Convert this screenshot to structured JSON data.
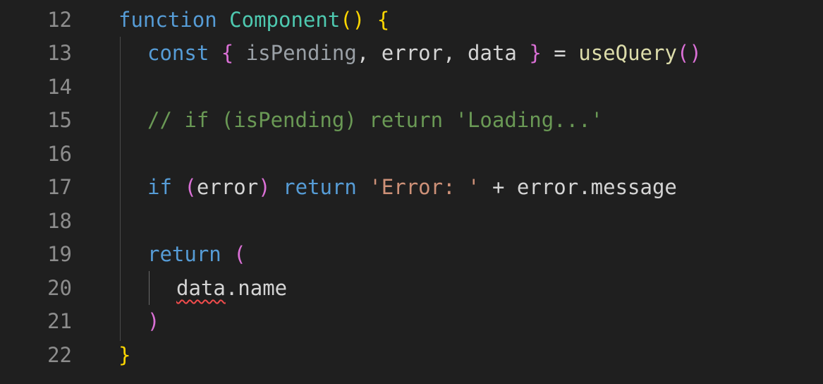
{
  "editor": {
    "line_numbers": [
      "12",
      "13",
      "14",
      "15",
      "16",
      "17",
      "18",
      "19",
      "20",
      "21",
      "22"
    ],
    "lines": {
      "l12": {
        "kw_function": "function",
        "name": "Component",
        "parens": "()",
        "brace_open": "{"
      },
      "l13": {
        "kw_const": "const",
        "brace_open": "{",
        "v1": "isPending",
        "comma1": ",",
        "v2": "error",
        "comma2": ",",
        "v3": "data",
        "brace_close": "}",
        "eq": "=",
        "call": "useQuery",
        "parens": "()"
      },
      "l15": {
        "comment": "// if (isPending) return 'Loading...'"
      },
      "l17": {
        "kw_if": "if",
        "paren_open": "(",
        "cond": "error",
        "paren_close": ")",
        "kw_return": "return",
        "str": "'Error: '",
        "plus": "+",
        "expr": "error.message"
      },
      "l19": {
        "kw_return": "return",
        "paren_open": "("
      },
      "l20": {
        "obj": "data",
        "rest": ".name"
      },
      "l21": {
        "paren_close": ")"
      },
      "l22": {
        "brace_close": "}"
      }
    },
    "colors": {
      "background": "#1f1f1f",
      "line_number": "#8d8d8d",
      "keyword": "#569cd6",
      "function_name": "#4ec9b0",
      "function_call": "#dcdcaa",
      "comment": "#6a9955",
      "string": "#ce9178",
      "bracket_gold": "#ffd700",
      "bracket_pink": "#da70d6",
      "error_squiggle": "#f14c4c"
    }
  }
}
